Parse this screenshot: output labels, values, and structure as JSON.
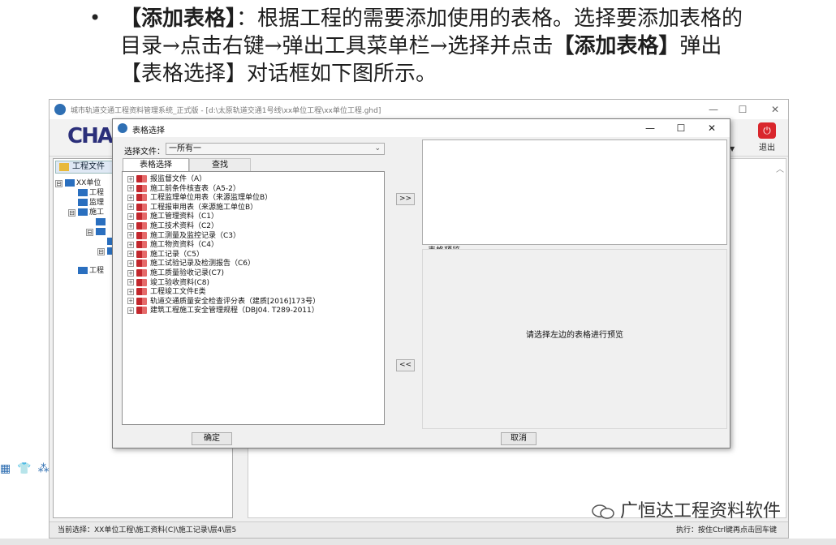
{
  "slide": {
    "bullet": "•",
    "para_bold_1": "【添加表格】",
    "para_1": "：根据工程的需要添加使用的表格。选择要添加表格的目录→点击右键→弹出工具菜单栏→选择并点击",
    "para_bold_2": "【添加表格】",
    "para_2": "弹出【表格选择】对话框如下图所示。"
  },
  "app": {
    "title": "城市轨道交通工程资料管理系统_正式版 - [d:\\太原轨道交通1号线\\xx单位工程\\xx单位工程.ghd]",
    "logo_text": "CHA",
    "exit_label": "退出",
    "left_tab_label": "工程文件",
    "tree": [
      {
        "label": "XX单位",
        "exp": "⊟"
      },
      {
        "label": "工程",
        "exp": ""
      },
      {
        "label": "监理",
        "exp": ""
      },
      {
        "label": "施工",
        "exp": "⊟"
      },
      {
        "label": "",
        "exp": ""
      },
      {
        "label": "",
        "exp": "⊟"
      },
      {
        "label": "",
        "exp": ""
      },
      {
        "label": "",
        "exp": "⊟"
      },
      {
        "label": "工程",
        "exp": ""
      }
    ],
    "status_left": "当前选择：XX单位工程\\施工资料(C)\\施工记录\\层4\\层5",
    "status_right": "执行：按住Ctrl键再点击回车键"
  },
  "dialog": {
    "title": "表格选择",
    "file_label": "选择文件：",
    "file_value": "一所有一",
    "tabs": [
      "表格选择",
      "查找"
    ],
    "items": [
      "报监督文件（A）",
      "施工前条件核查表（A5-2）",
      "工程监理单位用表（来源监理单位B）",
      "工程报审用表（来源施工单位B）",
      "施工管理资料（C1）",
      "施工技术资料（C2）",
      "施工测量及监控记录（C3）",
      "施工物资资料（C4）",
      "施工记录（C5）",
      "施工试验记录及检测报告（C6）",
      "施工质量验收记录(C7)",
      "竣工验收资料(C8)",
      "工程竣工文件E类",
      "轨道交通质量安全检查评分表（建质[2016]173号）",
      "建筑工程施工安全管理规程（DBJ04. T289-2011）"
    ],
    "add_btn": ">>",
    "remove_btn": "<<",
    "preview_label": "表格预览",
    "preview_hint": "请选择左边的表格进行预览",
    "ok_label": "确定",
    "cancel_label": "取消"
  },
  "watermark": "广恒达工程资料软件"
}
